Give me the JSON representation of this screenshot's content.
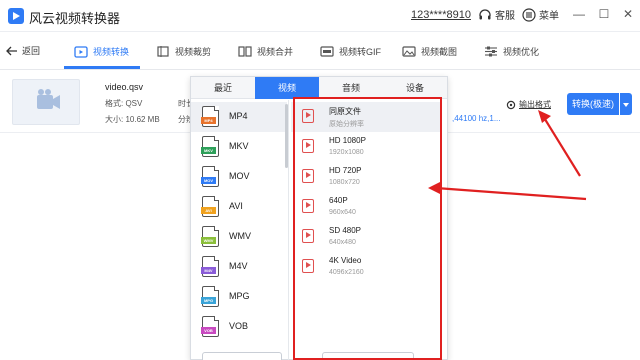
{
  "app": {
    "title": "风云视频转换器",
    "user_id": "123****8910",
    "kefu_label": "客服",
    "menu_label": "菜单"
  },
  "nav": {
    "back_label": "返回",
    "items": [
      {
        "label": "视频转换",
        "icon": "video-convert-icon",
        "active": true
      },
      {
        "label": "视频裁剪",
        "icon": "crop-icon"
      },
      {
        "label": "视频合并",
        "icon": "merge-icon"
      },
      {
        "label": "视频转GIF",
        "icon": "gif-icon"
      },
      {
        "label": "视频截图",
        "icon": "image-icon"
      },
      {
        "label": "视频优化",
        "icon": "sliders-icon"
      }
    ]
  },
  "file": {
    "name": "video.qsv",
    "format": "格式: QSV",
    "size": "大小: 10.62 MB",
    "truncated_1": "时长",
    "truncated_2": "分辨",
    "audio_info": ",44100 hz,1...",
    "output_format_label": "输出格式",
    "convert_button": "转换(极速)"
  },
  "dialog": {
    "tabs": [
      "最近",
      "视频",
      "音频",
      "设备"
    ],
    "active_tab": 1,
    "formats": [
      {
        "label": "MP4",
        "badge": "MP4",
        "color": "#e8732c"
      },
      {
        "label": "MKV",
        "badge": "MKV",
        "color": "#2ea05a"
      },
      {
        "label": "MOV",
        "badge": "MOV",
        "color": "#2f7bf5"
      },
      {
        "label": "AVI",
        "badge": "AVI",
        "color": "#f0a21e"
      },
      {
        "label": "WMV",
        "badge": "WMV",
        "color": "#8bbf3a"
      },
      {
        "label": "M4V",
        "badge": "M4V",
        "color": "#8a5cd8"
      },
      {
        "label": "MPG",
        "badge": "MPG",
        "color": "#3aa4d8"
      },
      {
        "label": "VOB",
        "badge": "VOB",
        "color": "#c84ac0"
      }
    ],
    "resolutions": [
      {
        "name": "同原文件",
        "sub": "原始分辨率"
      },
      {
        "name": "HD 1080P",
        "sub": "1920x1080"
      },
      {
        "name": "HD 720P",
        "sub": "1080x720"
      },
      {
        "name": "640P",
        "sub": "960x640"
      },
      {
        "name": "SD 480P",
        "sub": "640x480"
      },
      {
        "name": "4K Video",
        "sub": "4096x2160"
      }
    ]
  },
  "colors": {
    "accent": "#2f7bf5",
    "annotation": "#e02020"
  }
}
